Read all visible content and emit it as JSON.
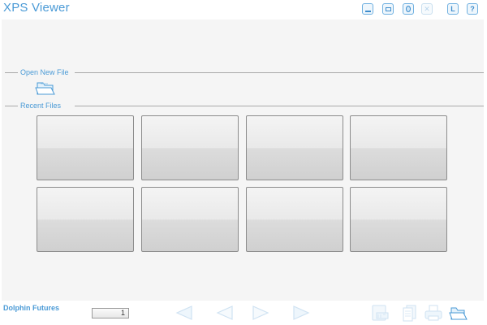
{
  "window": {
    "title": "XPS Viewer",
    "buttons": [
      {
        "name": "minimize",
        "icon": "minimize-icon"
      },
      {
        "name": "maximize",
        "icon": "maximize-icon"
      },
      {
        "name": "restore",
        "icon": "restore-icon"
      },
      {
        "name": "close",
        "icon": "close-icon",
        "disabled": true
      },
      {
        "name": "lock",
        "label": "L"
      },
      {
        "name": "help",
        "label": "?"
      }
    ]
  },
  "sections": {
    "open_new": {
      "label": "Open New File",
      "icon": "open-folder-icon"
    },
    "recent": {
      "label": "Recent Files",
      "tiles": [
        "",
        "",
        "",
        "",
        "",
        "",
        "",
        ""
      ]
    }
  },
  "footer": {
    "company": "Dolphin Futures",
    "page_number": "1",
    "nav": [
      "first-page-icon",
      "previous-page-icon",
      "next-page-icon",
      "last-page-icon"
    ],
    "tools": [
      "pdf-export-icon",
      "document-pages-icon",
      "print-icon",
      "open-folder-icon"
    ]
  },
  "colors": {
    "accent": "#4a9ad6",
    "panel": "#f5f5f5",
    "tile_border": "#8c8c8c",
    "disabled_icon": "#cfe2f2"
  }
}
